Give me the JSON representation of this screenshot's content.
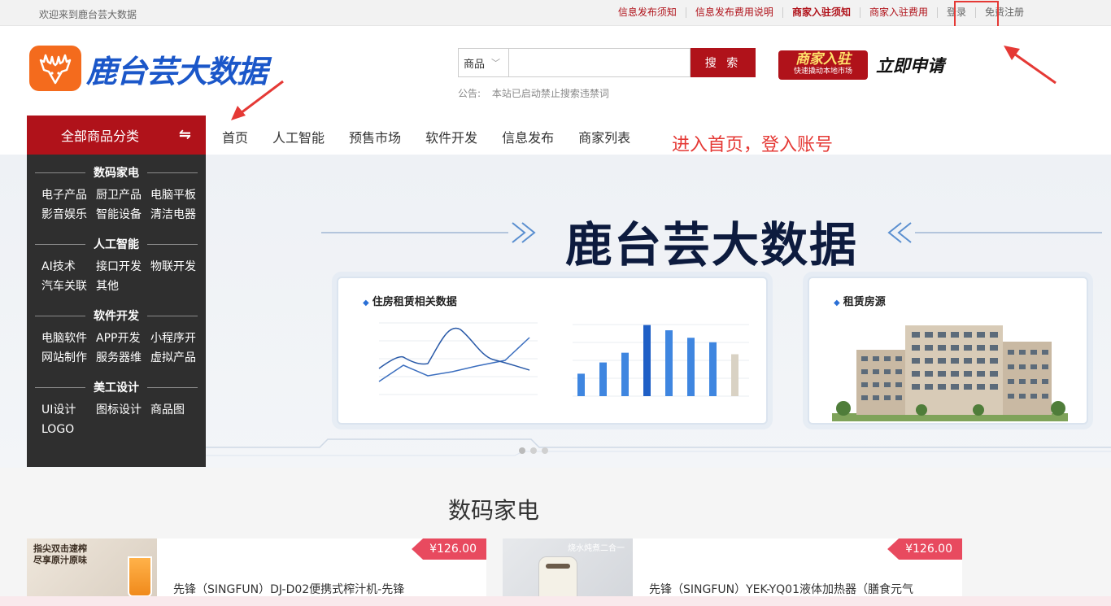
{
  "topbar": {
    "welcome": "欢迎来到鹿台芸大数据",
    "links": [
      "信息发布须知",
      "信息发布费用说明",
      "商家入驻须知",
      "商家入驻费用",
      "登录",
      "免费注册"
    ]
  },
  "logo": {
    "text": "鹿台芸大数据"
  },
  "search": {
    "category": "商品",
    "placeholder": "",
    "button": "搜 索",
    "notice_label": "公告:",
    "notice_text": "本站已启动禁止搜索违禁词"
  },
  "promo": {
    "badge_big": "商家入驻",
    "badge_small": "快速撬动本地市场",
    "apply": "立即申请"
  },
  "nav": {
    "all_categories": "全部商品分类",
    "swap_icon": "⇋",
    "items": [
      "首页",
      "人工智能",
      "预售市场",
      "软件开发",
      "信息发布",
      "商家列表"
    ]
  },
  "annotation": {
    "text": "进入首页，登入账号",
    "color": "#e53935"
  },
  "categories": [
    {
      "title": "数码家电",
      "items": [
        "电子产品",
        "厨卫产品",
        "电脑平板",
        "影音娱乐",
        "智能设备",
        "清洁电器"
      ]
    },
    {
      "title": "人工智能",
      "items": [
        "AI技术",
        "接口开发",
        "物联开发",
        "汽车关联",
        "其他"
      ]
    },
    {
      "title": "软件开发",
      "items": [
        "电脑软件",
        "APP开发",
        "小程序开",
        "网站制作",
        "服务器维",
        "虚拟产品"
      ]
    },
    {
      "title": "美工设计",
      "items": [
        "UI设计",
        "图标设计",
        "商品图",
        "LOGO"
      ]
    }
  ],
  "banner": {
    "title": "鹿台芸大数据",
    "card1_title": "住房租赁相关数据",
    "card2_title": "租赁房源",
    "bar_values": [
      30,
      45,
      58,
      95,
      88,
      78,
      72,
      56
    ]
  },
  "section": {
    "title": "数码家电",
    "products": [
      {
        "image_tag": "指尖双击速榨\n尽享原汁原味",
        "price": "¥126.00",
        "name": "先锋（SINGFUN）DJ-D02便携式榨汁机-先锋"
      },
      {
        "image_tag": "烧水炖煮二合一",
        "price": "¥126.00",
        "name": "先锋（SINGFUN）YEK-YQ01液体加热器（膳食元气"
      }
    ]
  },
  "colors": {
    "brand_red": "#b0121a",
    "logo_blue": "#1b57c9",
    "logo_orange": "#f46b1d",
    "price_red": "#e84a5f",
    "panel_dark": "#2f2f2f"
  }
}
